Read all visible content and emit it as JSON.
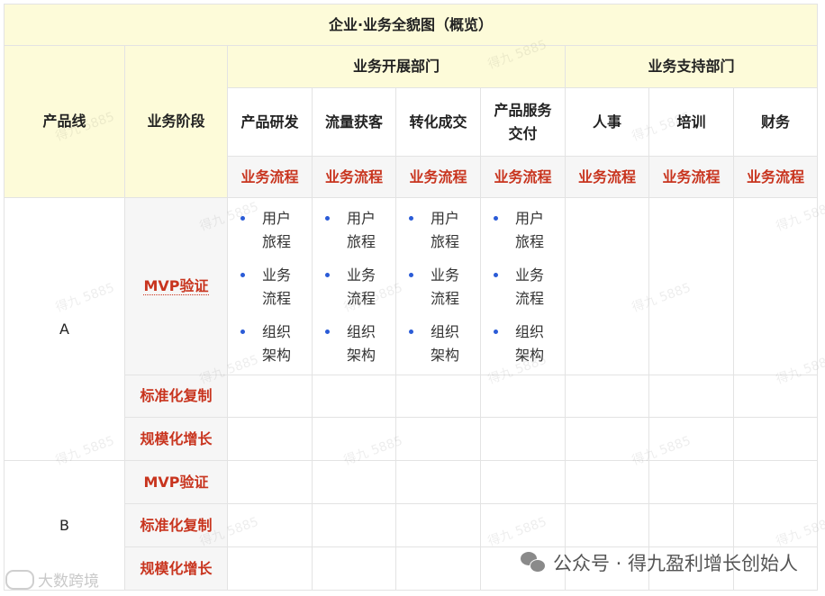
{
  "title": "企业·业务全貌图（概览）",
  "headers": {
    "product_line": "产品线",
    "stage": "业务阶段",
    "dev_group": "业务开展部门",
    "support_group": "业务支持部门",
    "departments": [
      "产品研发",
      "流量获客",
      "转化成交",
      "产品服务交付",
      "人事",
      "培训",
      "财务"
    ],
    "flow_label": "业务流程"
  },
  "rows": [
    {
      "line": "A",
      "stages": [
        "MVP验证",
        "标准化复制",
        "规模化增长"
      ]
    },
    {
      "line": "B",
      "stages": [
        "MVP验证",
        "标准化复制",
        "规模化增长"
      ]
    }
  ],
  "cell_items": [
    "用户旅程",
    "业务流程",
    "组织架构"
  ],
  "watermark": "得九 5885",
  "footer": {
    "brand": "公众号 · 得九盈利增长创始人",
    "logo_text": "大数跨境"
  },
  "colors": {
    "header_bg": "#fdfbd9",
    "stage_bg": "#f6f6f6",
    "accent_red": "#c8341e",
    "bullet_blue": "#2a5bd7"
  },
  "icons": [
    "wechat-icon",
    "brand-logo-icon"
  ]
}
